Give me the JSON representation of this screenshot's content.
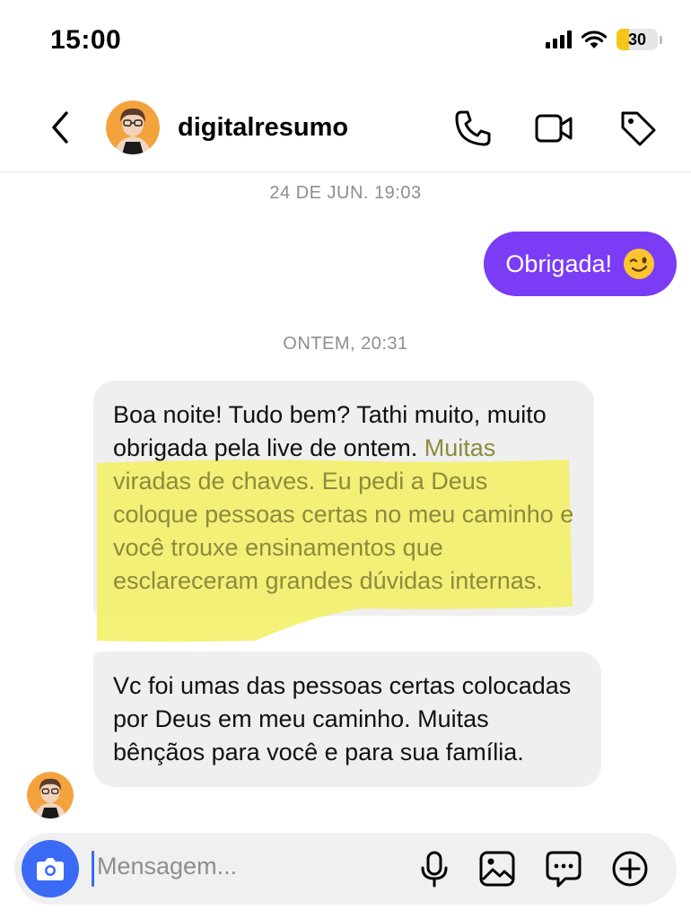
{
  "status": {
    "time": "15:00",
    "battery": "30",
    "battery_level": 0.3
  },
  "header": {
    "username": "digitalresumo"
  },
  "thread": {
    "timestamp_1": "24 DE JUN. 19:03",
    "outgoing_message": "Obrigada!",
    "outgoing_emoji": "winking-face-emoji",
    "timestamp_2": "ONTEM, 20:31",
    "message_1": {
      "plain": "Boa noite! Tudo bem? Tathi muito, muito obrigada pela live de ontem.",
      "highlighted": "Muitas viradas de chaves. Eu pedi a Deus coloque pessoas certas no meu caminho e você trouxe ensinamentos que esclareceram grandes dúvidas internas."
    },
    "message_2": "Vc foi umas das pessoas certas colocadas por Deus em meu caminho. Muitas bênçãos para você e para sua família."
  },
  "composer": {
    "placeholder": "Mensagem..."
  },
  "colors": {
    "accent": "#7b3cf5",
    "camera": "#3b6bf5",
    "highlight": "#f2f062",
    "bubble": "#efefef"
  },
  "icons": [
    "back-icon",
    "phone-icon",
    "video-icon",
    "tag-icon",
    "camera-icon",
    "microphone-icon",
    "gallery-icon",
    "sticker-icon",
    "plus-icon"
  ]
}
